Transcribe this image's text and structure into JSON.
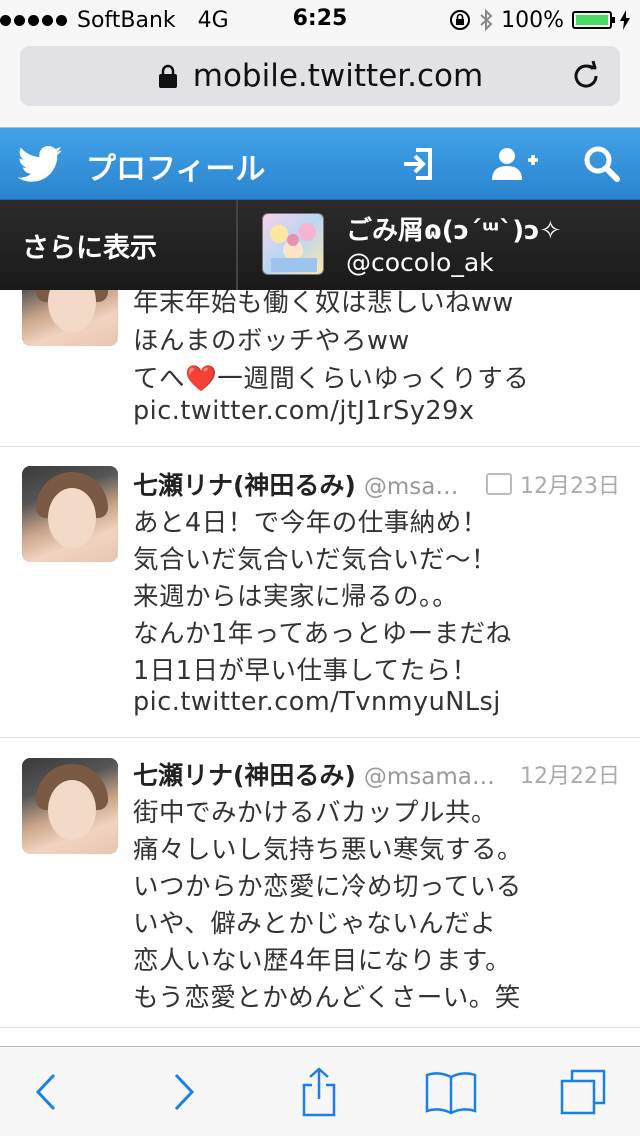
{
  "status_bar": {
    "carrier": "SoftBank",
    "network": "4G",
    "time": "6:25",
    "battery": "100%"
  },
  "url_bar": {
    "url": "mobile.twitter.com"
  },
  "header": {
    "title": "プロフィール"
  },
  "account": {
    "more_label": "さらに表示",
    "name": "ごみ屑ɷ(ↄ´ᵚ`)ↄ✧",
    "handle": "@cocolo_ak"
  },
  "tweets": [
    {
      "lines": [
        "年末年始も働く奴は悲しいねww",
        "ほんまのボッチやろww",
        "てへ❤️一週間くらいゆっくりする",
        "pic.twitter.com/jtJ1rSy29x"
      ]
    },
    {
      "name": "七瀬リナ(神田るみ)",
      "handle": "@msa…",
      "date": "12月23日",
      "lines": [
        "あと4日！で今年の仕事納め！",
        "気合いだ気合いだ気合いだ〜！",
        "来週からは実家に帰るの。。",
        "なんか1年ってあっとゆーまだね",
        "1日1日が早い仕事してたら！",
        "pic.twitter.com/TvnmyuNLsj"
      ]
    },
    {
      "name": "七瀬リナ(神田るみ)",
      "handle": "@msama…",
      "date": "12月22日",
      "lines": [
        "街中でみかけるバカップル共。",
        "痛々しいし気持ち悪い寒気する。",
        "いつからか恋愛に冷め切っている",
        "いや、僻みとかじゃないんだよ",
        "恋人いない歴4年目になります。",
        "もう恋愛とかめんどくさーい。笑"
      ]
    }
  ],
  "colors": {
    "twitter_blue": "#2a85cf",
    "ios_blue": "#1a7fe6",
    "battery_green": "#4cd964"
  }
}
